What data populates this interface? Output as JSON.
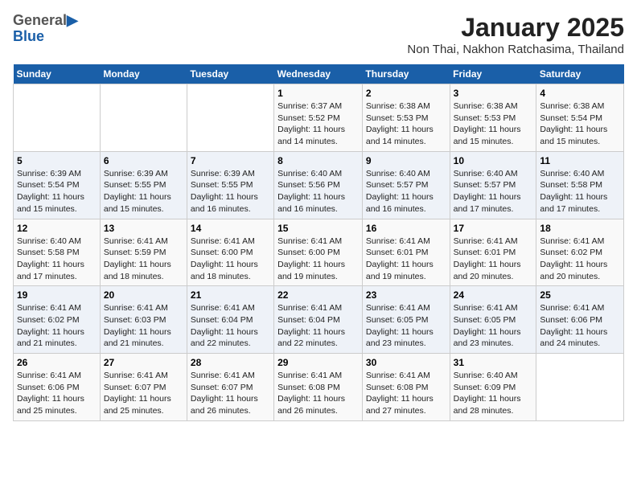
{
  "header": {
    "logo_general": "General",
    "logo_blue": "Blue",
    "title": "January 2025",
    "subtitle": "Non Thai, Nakhon Ratchasima, Thailand"
  },
  "days_of_week": [
    "Sunday",
    "Monday",
    "Tuesday",
    "Wednesday",
    "Thursday",
    "Friday",
    "Saturday"
  ],
  "weeks": [
    [
      {
        "day": "",
        "info": ""
      },
      {
        "day": "",
        "info": ""
      },
      {
        "day": "",
        "info": ""
      },
      {
        "day": "1",
        "info": "Sunrise: 6:37 AM\nSunset: 5:52 PM\nDaylight: 11 hours and 14 minutes."
      },
      {
        "day": "2",
        "info": "Sunrise: 6:38 AM\nSunset: 5:53 PM\nDaylight: 11 hours and 14 minutes."
      },
      {
        "day": "3",
        "info": "Sunrise: 6:38 AM\nSunset: 5:53 PM\nDaylight: 11 hours and 15 minutes."
      },
      {
        "day": "4",
        "info": "Sunrise: 6:38 AM\nSunset: 5:54 PM\nDaylight: 11 hours and 15 minutes."
      }
    ],
    [
      {
        "day": "5",
        "info": "Sunrise: 6:39 AM\nSunset: 5:54 PM\nDaylight: 11 hours and 15 minutes."
      },
      {
        "day": "6",
        "info": "Sunrise: 6:39 AM\nSunset: 5:55 PM\nDaylight: 11 hours and 15 minutes."
      },
      {
        "day": "7",
        "info": "Sunrise: 6:39 AM\nSunset: 5:55 PM\nDaylight: 11 hours and 16 minutes."
      },
      {
        "day": "8",
        "info": "Sunrise: 6:40 AM\nSunset: 5:56 PM\nDaylight: 11 hours and 16 minutes."
      },
      {
        "day": "9",
        "info": "Sunrise: 6:40 AM\nSunset: 5:57 PM\nDaylight: 11 hours and 16 minutes."
      },
      {
        "day": "10",
        "info": "Sunrise: 6:40 AM\nSunset: 5:57 PM\nDaylight: 11 hours and 17 minutes."
      },
      {
        "day": "11",
        "info": "Sunrise: 6:40 AM\nSunset: 5:58 PM\nDaylight: 11 hours and 17 minutes."
      }
    ],
    [
      {
        "day": "12",
        "info": "Sunrise: 6:40 AM\nSunset: 5:58 PM\nDaylight: 11 hours and 17 minutes."
      },
      {
        "day": "13",
        "info": "Sunrise: 6:41 AM\nSunset: 5:59 PM\nDaylight: 11 hours and 18 minutes."
      },
      {
        "day": "14",
        "info": "Sunrise: 6:41 AM\nSunset: 6:00 PM\nDaylight: 11 hours and 18 minutes."
      },
      {
        "day": "15",
        "info": "Sunrise: 6:41 AM\nSunset: 6:00 PM\nDaylight: 11 hours and 19 minutes."
      },
      {
        "day": "16",
        "info": "Sunrise: 6:41 AM\nSunset: 6:01 PM\nDaylight: 11 hours and 19 minutes."
      },
      {
        "day": "17",
        "info": "Sunrise: 6:41 AM\nSunset: 6:01 PM\nDaylight: 11 hours and 20 minutes."
      },
      {
        "day": "18",
        "info": "Sunrise: 6:41 AM\nSunset: 6:02 PM\nDaylight: 11 hours and 20 minutes."
      }
    ],
    [
      {
        "day": "19",
        "info": "Sunrise: 6:41 AM\nSunset: 6:02 PM\nDaylight: 11 hours and 21 minutes."
      },
      {
        "day": "20",
        "info": "Sunrise: 6:41 AM\nSunset: 6:03 PM\nDaylight: 11 hours and 21 minutes."
      },
      {
        "day": "21",
        "info": "Sunrise: 6:41 AM\nSunset: 6:04 PM\nDaylight: 11 hours and 22 minutes."
      },
      {
        "day": "22",
        "info": "Sunrise: 6:41 AM\nSunset: 6:04 PM\nDaylight: 11 hours and 22 minutes."
      },
      {
        "day": "23",
        "info": "Sunrise: 6:41 AM\nSunset: 6:05 PM\nDaylight: 11 hours and 23 minutes."
      },
      {
        "day": "24",
        "info": "Sunrise: 6:41 AM\nSunset: 6:05 PM\nDaylight: 11 hours and 23 minutes."
      },
      {
        "day": "25",
        "info": "Sunrise: 6:41 AM\nSunset: 6:06 PM\nDaylight: 11 hours and 24 minutes."
      }
    ],
    [
      {
        "day": "26",
        "info": "Sunrise: 6:41 AM\nSunset: 6:06 PM\nDaylight: 11 hours and 25 minutes."
      },
      {
        "day": "27",
        "info": "Sunrise: 6:41 AM\nSunset: 6:07 PM\nDaylight: 11 hours and 25 minutes."
      },
      {
        "day": "28",
        "info": "Sunrise: 6:41 AM\nSunset: 6:07 PM\nDaylight: 11 hours and 26 minutes."
      },
      {
        "day": "29",
        "info": "Sunrise: 6:41 AM\nSunset: 6:08 PM\nDaylight: 11 hours and 26 minutes."
      },
      {
        "day": "30",
        "info": "Sunrise: 6:41 AM\nSunset: 6:08 PM\nDaylight: 11 hours and 27 minutes."
      },
      {
        "day": "31",
        "info": "Sunrise: 6:40 AM\nSunset: 6:09 PM\nDaylight: 11 hours and 28 minutes."
      },
      {
        "day": "",
        "info": ""
      }
    ]
  ]
}
